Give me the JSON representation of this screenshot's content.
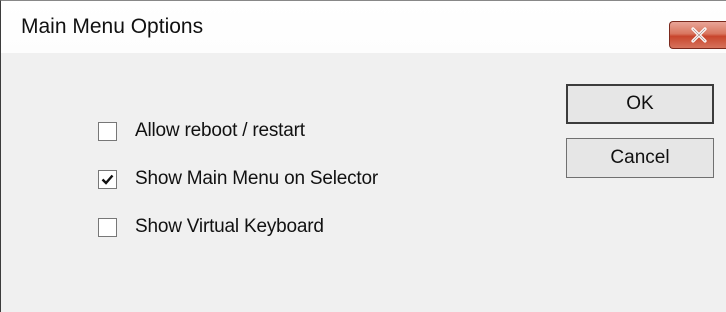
{
  "window": {
    "title": "Main Menu Options",
    "close_icon": "close-icon"
  },
  "options": [
    {
      "label": "Allow reboot / restart",
      "checked": false
    },
    {
      "label": "Show Main Menu on Selector",
      "checked": true
    },
    {
      "label": "Show Virtual Keyboard",
      "checked": false
    }
  ],
  "buttons": {
    "ok_label": "OK",
    "cancel_label": "Cancel"
  },
  "colors": {
    "close_button": "#c8452c",
    "dialog_background": "#f0f0f0"
  }
}
